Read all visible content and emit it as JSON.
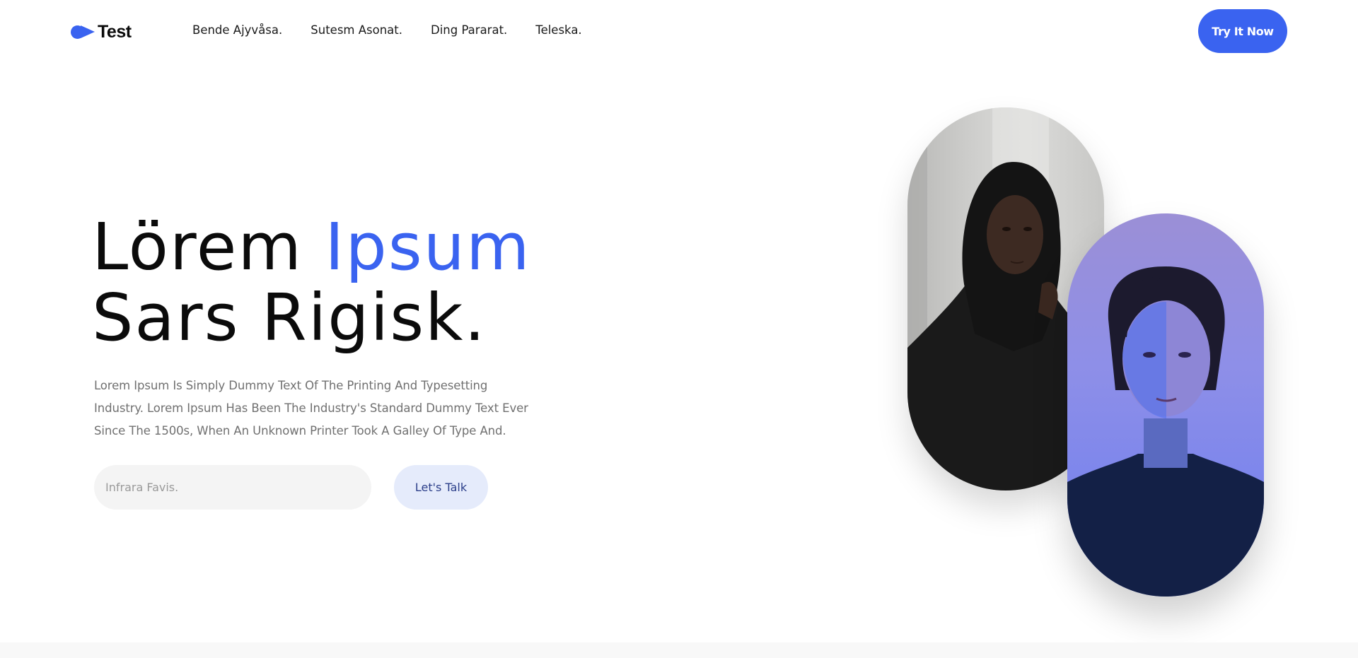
{
  "header": {
    "logo_text": "Test",
    "nav": [
      "Bende Ajyvåsa.",
      "Sutesm Asonat.",
      "Ding Pararat.",
      "Teleska."
    ],
    "cta_label": "Try It Now"
  },
  "hero": {
    "title_word_1": "Lörem",
    "title_word_2": "Ipsum",
    "title_line_2": "Sars Rigisk.",
    "description": "Lorem Ipsum Is Simply Dummy Text Of The Printing And Typesetting Industry. Lorem Ipsum Has Been The Industry's Standard Dummy Text Ever Since The 1500s, When An Unknown Printer Took A Galley Of Type And.",
    "input_placeholder": "Infrara Favis.",
    "talk_button_label": "Let's Talk"
  },
  "colors": {
    "accent": "#3a63f0",
    "talk_button_bg": "#e5ebfb",
    "input_bg": "#f4f4f4",
    "text_muted": "#707070"
  }
}
